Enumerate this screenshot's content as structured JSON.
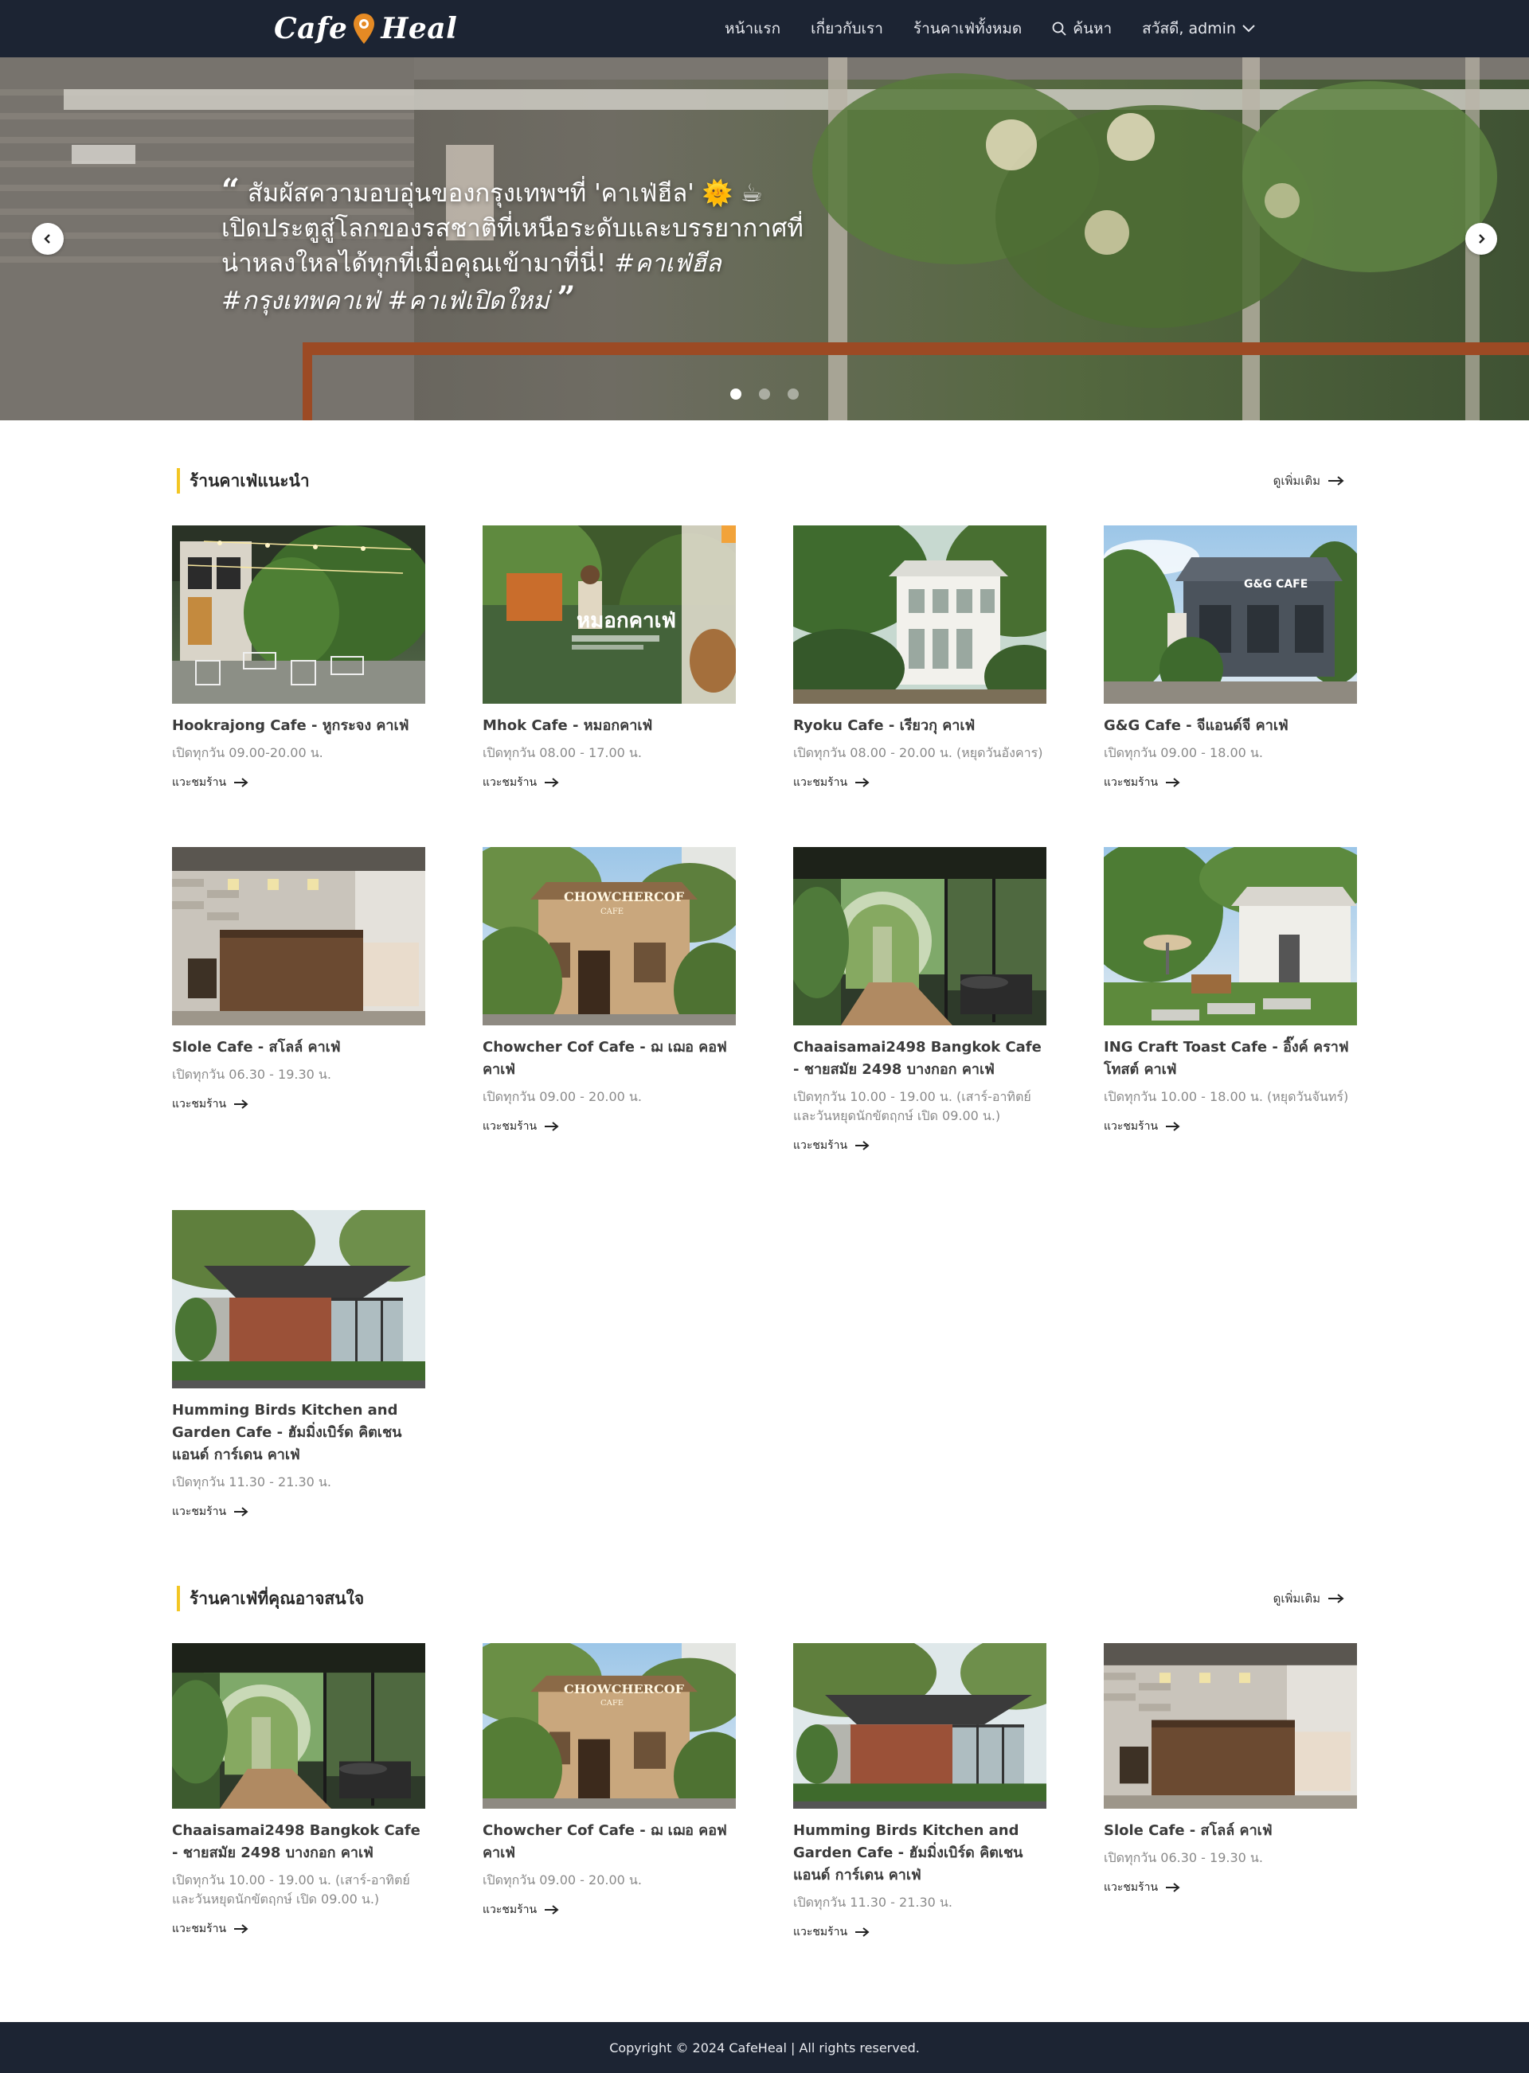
{
  "brand": {
    "word1": "Cafe",
    "word2": "Heal",
    "pin_color": "#e58a24"
  },
  "nav": {
    "home": "หน้าแรก",
    "about": "เกี่ยวกับเรา",
    "all_cafes": "ร้านคาเฟ่ทั้งหมด",
    "search": "ค้นหา",
    "user": "สวัสดี, admin"
  },
  "hero": {
    "quote_line1": "สัมผัสความอบอุ่นของกรุงเทพฯที่ 'คาเฟ่ฮีล' 🌞 ☕",
    "quote_line2": "เปิดประตูสู่โลกของรสชาติที่เหนือระดับและบรรยากาศที่",
    "quote_line3": "น่าหลงใหลได้ทุกที่เมื่อคุณเข้ามาที่นี่!",
    "quote_tags": "#คาเฟ่ฮีล #กรุงเทพคาเฟ่ #คาเฟ่เปิดใหม่",
    "slide_count": 3,
    "active_slide": 1
  },
  "recommended": {
    "title": "ร้านคาเฟ่แนะนำ",
    "see_more": "ดูเพิ่มเติม",
    "cards": [
      {
        "name": "Hookrajong Cafe - หูกระจง คาเฟ่",
        "hours": "เปิดทุกวัน 09.00-20.00 น.",
        "link": "แวะชมร้าน"
      },
      {
        "name": "Mhok Cafe - หมอกคาเฟ่",
        "hours": "เปิดทุกวัน 08.00 - 17.00 น.",
        "link": "แวะชมร้าน"
      },
      {
        "name": "Ryoku Cafe - เรียวกุ คาเฟ่",
        "hours": "เปิดทุกวัน 08.00 - 20.00 น. (หยุดวันอังคาร)",
        "link": "แวะชมร้าน"
      },
      {
        "name": "G&G Cafe - จีแอนด์จี คาเฟ่",
        "hours": "เปิดทุกวัน 09.00 - 18.00 น.",
        "link": "แวะชมร้าน"
      },
      {
        "name": "Slole Cafe - สโลล์ คาเฟ่",
        "hours": "เปิดทุกวัน 06.30 - 19.30 น.",
        "link": "แวะชมร้าน"
      },
      {
        "name": "Chowcher Cof Cafe - ฌ เฌอ คอฟ คาเฟ่",
        "hours": "เปิดทุกวัน 09.00 - 20.00 น.",
        "link": "แวะชมร้าน"
      },
      {
        "name": "Chaaisamai2498 Bangkok Cafe - ชายสมัย 2498 บางกอก คาเฟ่",
        "hours": "เปิดทุกวัน 10.00 - 19.00 น. (เสาร์-อาทิตย์ และวันหยุดนักขัตฤกษ์ เปิด 09.00 น.)",
        "link": "แวะชมร้าน"
      },
      {
        "name": "ING Craft Toast Cafe - อิ๊งค์ คราฟ โทสต์ คาเฟ่",
        "hours": "เปิดทุกวัน 10.00 - 18.00 น. (หยุดวันจันทร์)",
        "link": "แวะชมร้าน"
      },
      {
        "name": "Humming Birds Kitchen and Garden Cafe - ฮัมมิ่งเบิร์ด คิตเชน แอนด์ การ์เดน คาเฟ่",
        "hours": "เปิดทุกวัน 11.30 - 21.30 น.",
        "link": "แวะชมร้าน"
      }
    ]
  },
  "interest": {
    "title": "ร้านคาเฟ่ที่คุณอาจสนใจ",
    "see_more": "ดูเพิ่มเติม",
    "cards": [
      {
        "name": "Chaaisamai2498 Bangkok Cafe - ชายสมัย 2498 บางกอก คาเฟ่",
        "hours": "เปิดทุกวัน 10.00 - 19.00 น. (เสาร์-อาทิตย์ และวันหยุดนักขัตฤกษ์ เปิด 09.00 น.)",
        "link": "แวะชมร้าน"
      },
      {
        "name": "Chowcher Cof Cafe - ฌ เฌอ คอฟ คาเฟ่",
        "hours": "เปิดทุกวัน 09.00 - 20.00 น.",
        "link": "แวะชมร้าน"
      },
      {
        "name": "Humming Birds Kitchen and Garden Cafe - ฮัมมิ่งเบิร์ด คิตเชน แอนด์ การ์เดน คาเฟ่",
        "hours": "เปิดทุกวัน 11.30 - 21.30 น.",
        "link": "แวะชมร้าน"
      },
      {
        "name": "Slole Cafe - สโลล์ คาเฟ่",
        "hours": "เปิดทุกวัน 06.30 - 19.30 น.",
        "link": "แวะชมร้าน"
      }
    ]
  },
  "photo_text": {
    "mhok_sign": "หมอกคาเฟ่",
    "gg_sign": "G&G CAFE",
    "chowcher_sign": "CHOWCHERCOF",
    "chowcher_sub": "CAFE"
  },
  "footer": {
    "copyright": "Copyright © 2024 CafeHeal | All rights reserved."
  }
}
